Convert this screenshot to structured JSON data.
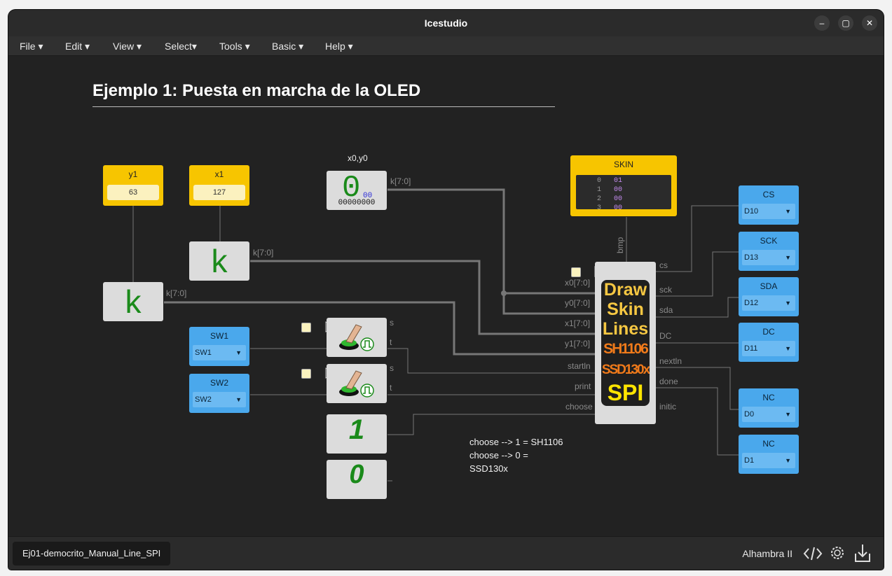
{
  "window": {
    "title": "Icestudio"
  },
  "menu": [
    "File",
    "Edit",
    "View",
    "Select",
    "Tools",
    "Basic",
    "Help"
  ],
  "heading": "Ejemplo 1: Puesta en marcha de la OLED",
  "blocks": {
    "y1": {
      "label": "y1",
      "value": "63"
    },
    "x1": {
      "label": "x1",
      "value": "127"
    },
    "x0y0": {
      "title": "x0,y0",
      "digit": "0",
      "hex": "00",
      "bin": "00000000",
      "port": "k[7:0]"
    },
    "k_x1": {
      "glyph": "k",
      "port": "k[7:0]"
    },
    "k_y1": {
      "glyph": "k",
      "port": "k[7:0]"
    },
    "skin": {
      "label": "SKIN",
      "rows": [
        {
          "addr": "0",
          "val": "01"
        },
        {
          "addr": "1",
          "val": "00"
        },
        {
          "addr": "2",
          "val": "00"
        },
        {
          "addr": "3",
          "val": "00"
        }
      ],
      "port": "bmp"
    },
    "sw1": {
      "label": "SW1",
      "value": "SW1"
    },
    "sw2": {
      "label": "SW2",
      "value": "SW2"
    },
    "btn1": {
      "s": "s",
      "t": "t"
    },
    "btn2": {
      "s": "s",
      "t": "t"
    },
    "one": {
      "glyph": "1"
    },
    "zero": {
      "glyph": "0"
    },
    "main": {
      "lines": [
        "Draw",
        "Skin",
        "Lines",
        "SH1106",
        "SSD130x",
        "SPI"
      ],
      "in_ports": [
        "x0[7:0]",
        "y0[7:0]",
        "x1[7:0]",
        "y1[7:0]",
        "startln",
        "print",
        "choose"
      ],
      "out_ports": [
        "cs",
        "sck",
        "sda",
        "DC",
        "nextln",
        "done",
        "initic"
      ]
    },
    "outputs": [
      {
        "label": "CS",
        "value": "D10"
      },
      {
        "label": "SCK",
        "value": "D13"
      },
      {
        "label": "SDA",
        "value": "D12"
      },
      {
        "label": "DC",
        "value": "D11"
      },
      {
        "label": "NC",
        "value": "D0"
      },
      {
        "label": "NC",
        "value": "D1"
      }
    ]
  },
  "note": [
    "choose --> 1 = SH1106",
    "choose --> 0 =",
    "SSD130x"
  ],
  "footer": {
    "tab": "Ej01-democrito_Manual_Line_SPI",
    "board": "Alhambra II"
  },
  "colors": {
    "yellow": "#f7c500",
    "blue": "#4aa8ec",
    "green_glyph": "#1a8a1a",
    "wire": "#777777"
  }
}
